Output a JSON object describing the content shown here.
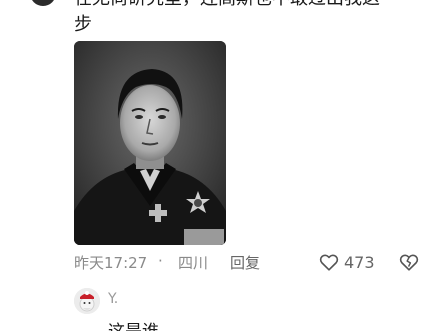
{
  "comment": {
    "text_line1": "在无尚研究室，连高斯也不敢过出我这",
    "text_line2": "步",
    "image_alt": "portrait-photo",
    "time": "昨天17:27",
    "separator": "·",
    "location": "四川",
    "reply_label": "回复",
    "like_count": "473"
  },
  "reply": {
    "user_name": "Y.",
    "text": "这是谁"
  },
  "icons": {
    "like": "heart-outline-icon",
    "dislike": "broken-heart-icon"
  },
  "colors": {
    "meta_text": "#8a8a8a",
    "primary_text": "#1a1a1a"
  }
}
